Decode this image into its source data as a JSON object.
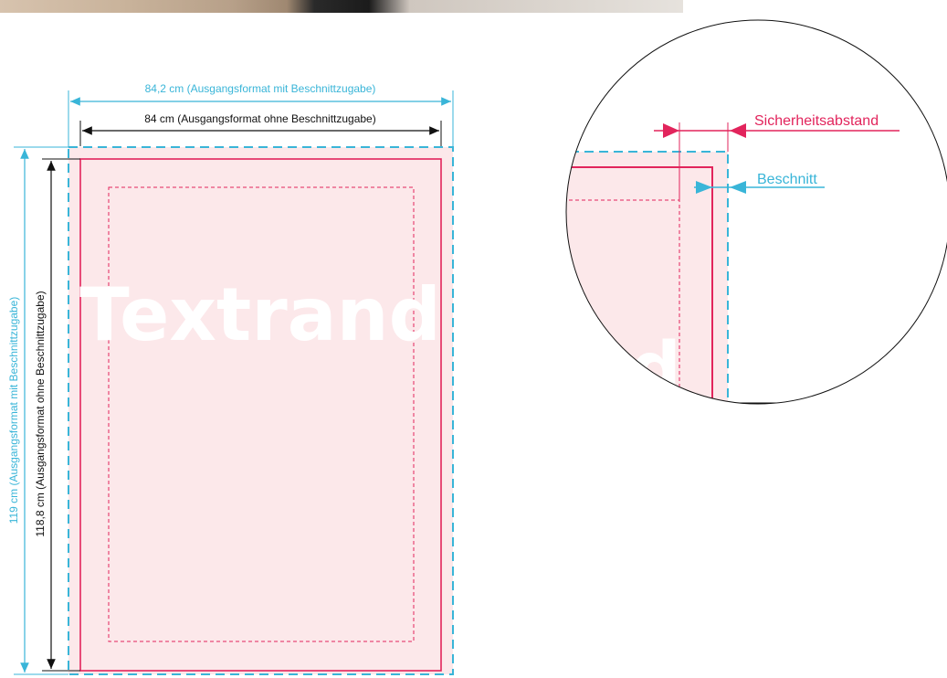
{
  "dimensions": {
    "width_with_bleed": "84,2 cm (Ausgangsformat mit  Beschnittzugabe)",
    "width_without_bleed": "84 cm (Ausgangsformat ohne  Beschnittzugabe)",
    "height_with_bleed": "119 cm  (Ausgangsformat mit  Beschnittzugabe)",
    "height_without_bleed": "118,8 cm  (Ausgangsformat ohne  Beschnittzugabe)"
  },
  "watermark_text": "Textrand",
  "magnifier": {
    "label_safety": "Sicherheitsabstand",
    "label_bleed": "Beschnitt",
    "partial_watermark": "d"
  },
  "colors": {
    "bleed": "#39b5d8",
    "trim": "#e2245c",
    "fill": "#fce8ea",
    "dimension": "#111111"
  }
}
